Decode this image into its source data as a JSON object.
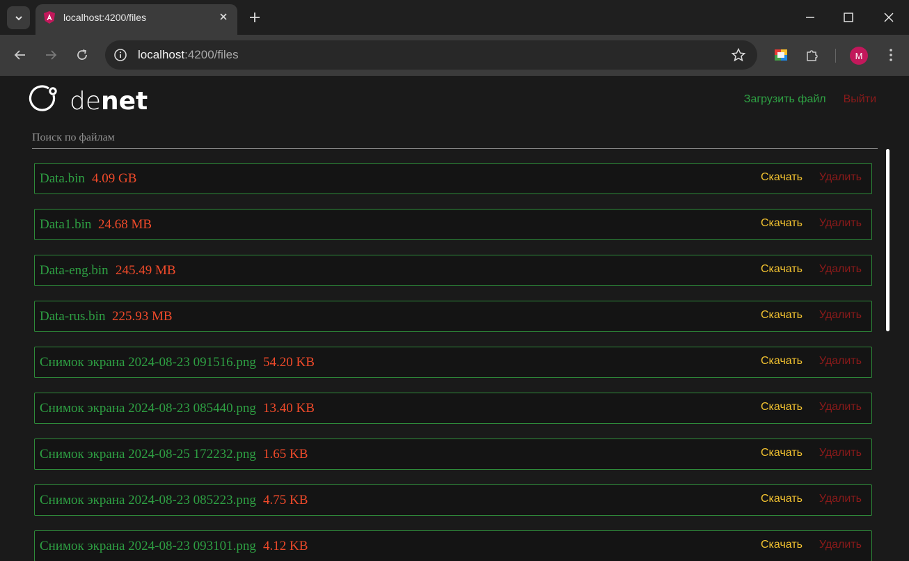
{
  "browser": {
    "tab_title": "localhost:4200/files",
    "url_host": "localhost",
    "url_path": ":4200/files",
    "profile_initial": "M"
  },
  "header": {
    "logo_text": "denet",
    "upload_label": "Загрузить файл",
    "logout_label": "Выйти"
  },
  "search": {
    "placeholder": "Поиск по файлам"
  },
  "actions": {
    "download_label": "Скачать",
    "delete_label": "Удалить"
  },
  "files": [
    {
      "name": "Data.bin",
      "size": "4.09 GB"
    },
    {
      "name": "Data1.bin",
      "size": "24.68 MB"
    },
    {
      "name": "Data-eng.bin",
      "size": "245.49 MB"
    },
    {
      "name": "Data-rus.bin",
      "size": "225.93 MB"
    },
    {
      "name": "Снимок экрана 2024-08-23 091516.png",
      "size": "54.20 KB"
    },
    {
      "name": "Снимок экрана 2024-08-23 085440.png",
      "size": "13.40 KB"
    },
    {
      "name": "Снимок экрана 2024-08-25 172232.png",
      "size": "1.65 KB"
    },
    {
      "name": "Снимок экрана 2024-08-23 085223.png",
      "size": "4.75 KB"
    },
    {
      "name": "Снимок экрана 2024-08-23 093101.png",
      "size": "4.12 KB"
    }
  ],
  "colors": {
    "file_name": "#2ea043",
    "file_size": "#f04a2a",
    "download": "#f2c230",
    "delete": "#8b1a1a",
    "row_border": "#2e8b3a"
  }
}
